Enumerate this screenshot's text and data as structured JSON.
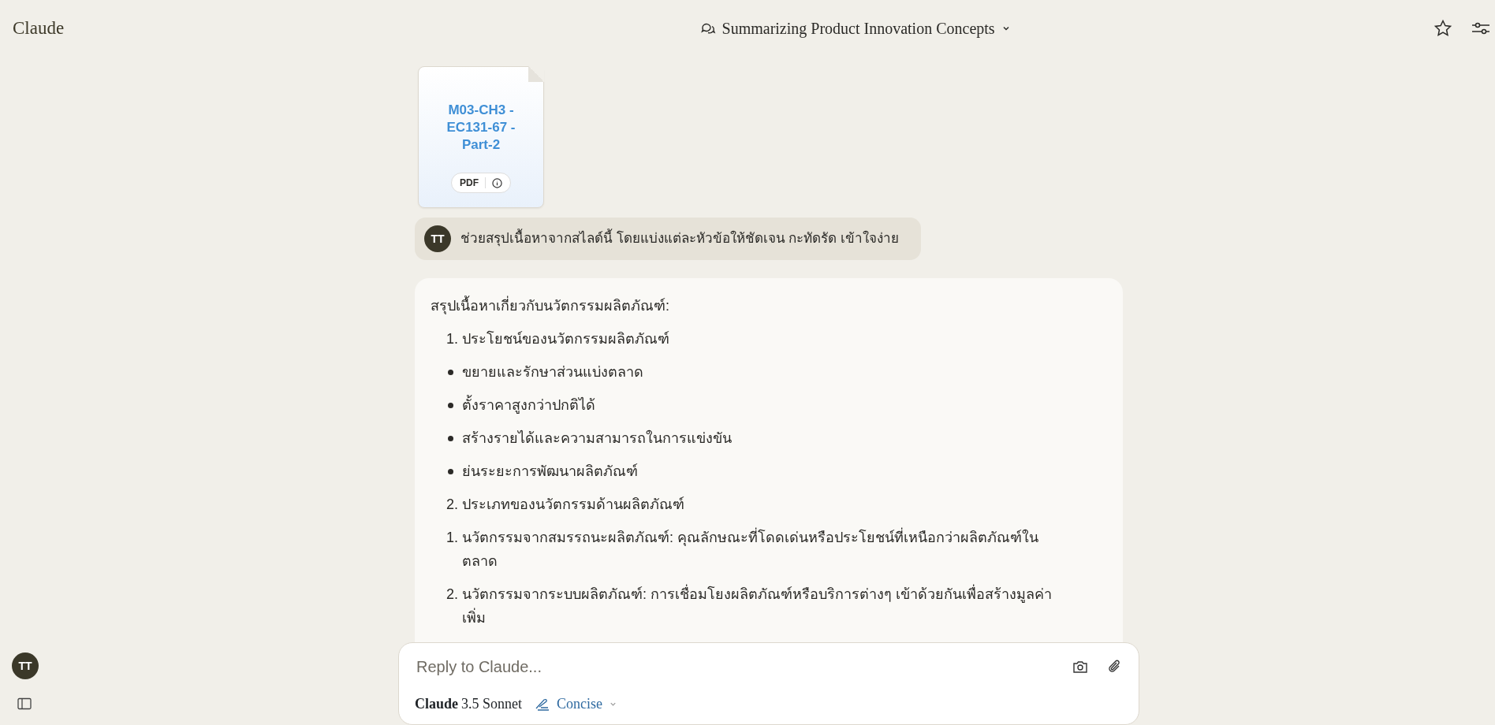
{
  "app": {
    "logo": "Claude"
  },
  "header": {
    "title": "Summarizing Product Innovation Concepts"
  },
  "attachment": {
    "name": "M03-CH3 - EC131-67 - Part-2",
    "type": "PDF"
  },
  "user_message": {
    "avatar": "TT",
    "text": "ช่วยสรุปเนื้อหาจากสไลด์นี้ โดยแบ่งแต่ละหัวข้อให้ชัดเจน กะทัดรัด เข้าใจง่าย"
  },
  "response": {
    "intro": "สรุปเนื้อหาเกี่ยวกับนวัตกรรมผลิตภัณฑ์:",
    "items": [
      {
        "kind": "numbered",
        "marker": "1.",
        "text": "ประโยชน์ของนวัตกรรมผลิตภัณฑ์"
      },
      {
        "kind": "bullet",
        "text": "ขยายและรักษาส่วนแบ่งตลาด"
      },
      {
        "kind": "bullet",
        "text": "ตั้งราคาสูงกว่าปกติได้"
      },
      {
        "kind": "bullet",
        "text": "สร้างรายได้และความสามารถในการแข่งขัน"
      },
      {
        "kind": "bullet",
        "text": "ย่นระยะการพัฒนาผลิตภัณฑ์"
      },
      {
        "kind": "numbered",
        "marker": "2.",
        "text": "ประเภทของนวัตกรรมด้านผลิตภัณฑ์"
      },
      {
        "kind": "numbered",
        "marker": "1.",
        "text": "นวัตกรรมจากสมรรถนะผลิตภัณฑ์: คุณลักษณะที่โดดเด่นหรือประโยชน์ที่เหนือกว่าผลิตภัณฑ์ใน ตลาด"
      },
      {
        "kind": "numbered",
        "marker": "2.",
        "text": "นวัตกรรมจากระบบผลิตภัณฑ์: การเชื่อมโยงผลิตภัณฑ์หรือบริการต่างๆ เข้าด้วยกันเพื่อสร้างมูลค่า เพิ่ม"
      }
    ]
  },
  "sidebar": {
    "avatar": "TT"
  },
  "composer": {
    "placeholder": "Reply to Claude...",
    "model_name": "Claude",
    "model_version": "3.5 Sonnet",
    "style": "Concise"
  }
}
